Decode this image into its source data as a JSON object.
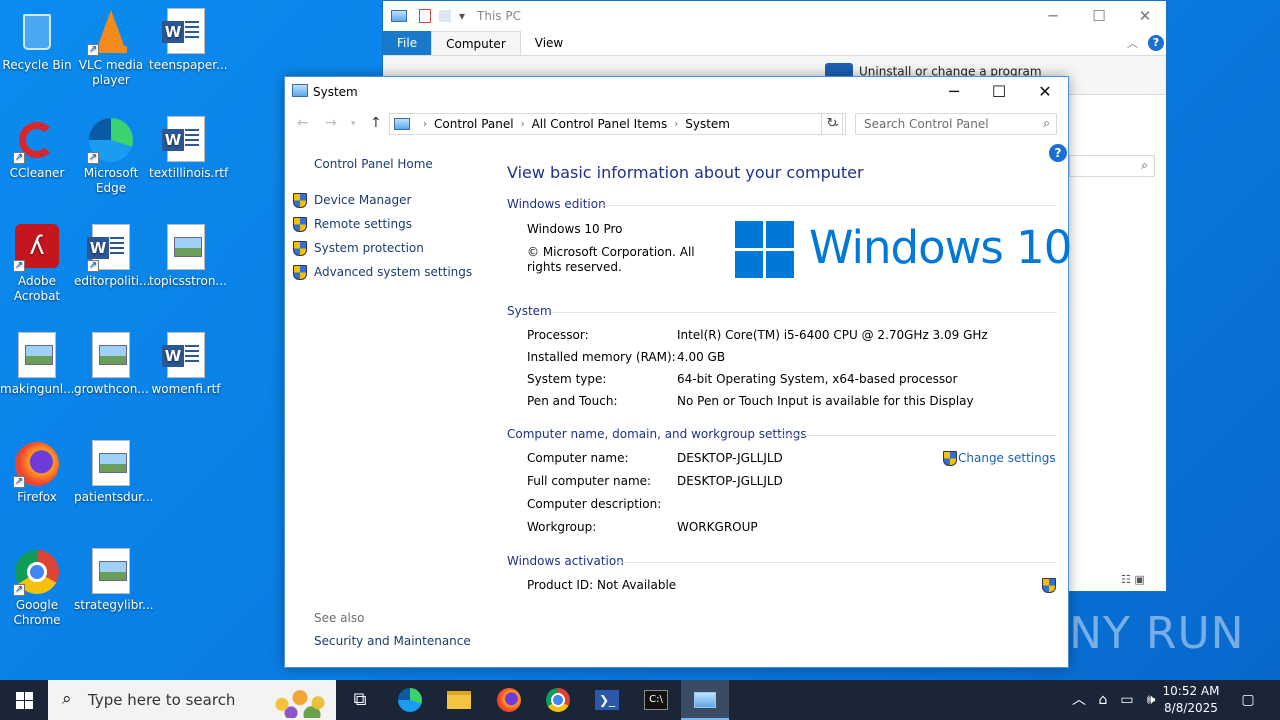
{
  "desktop": {
    "icons": [
      {
        "label": "Recycle Bin",
        "icon": "recycle-bin-icon"
      },
      {
        "label": "VLC media player",
        "icon": "vlc-icon"
      },
      {
        "label": "teenspaper...",
        "icon": "word-doc-icon"
      },
      {
        "label": "CCleaner",
        "icon": "ccleaner-icon"
      },
      {
        "label": "Microsoft Edge",
        "icon": "edge-icon"
      },
      {
        "label": "textillinois.rtf",
        "icon": "word-doc-icon"
      },
      {
        "label": "Adobe Acrobat",
        "icon": "acrobat-icon"
      },
      {
        "label": "editorpoliti...",
        "icon": "word-doc-icon"
      },
      {
        "label": "topicsstron...",
        "icon": "image-file-icon"
      },
      {
        "label": "makingunl...",
        "icon": "image-file-icon"
      },
      {
        "label": "growthcon...",
        "icon": "image-file-icon"
      },
      {
        "label": "womenfi.rtf",
        "icon": "word-doc-icon"
      },
      {
        "label": "Firefox",
        "icon": "firefox-icon"
      },
      {
        "label": "patientsdur...",
        "icon": "image-file-icon"
      },
      {
        "label": "Google Chrome",
        "icon": "chrome-icon"
      },
      {
        "label": "strategylibr...",
        "icon": "image-file-icon"
      }
    ]
  },
  "explorer": {
    "title": "This PC",
    "tabs": {
      "file": "File",
      "computer": "Computer",
      "view": "View"
    },
    "uninstall": "Uninstall or change a program"
  },
  "system_window": {
    "title": "System",
    "breadcrumb": [
      "Control Panel",
      "All Control Panel Items",
      "System"
    ],
    "search_placeholder": "Search Control Panel",
    "left_nav": {
      "home": "Control Panel Home",
      "items": [
        "Device Manager",
        "Remote settings",
        "System protection",
        "Advanced system settings"
      ],
      "see_also": "See also",
      "security": "Security and Maintenance"
    },
    "heading": "View basic information about your computer",
    "edition": {
      "section": "Windows edition",
      "name": "Windows 10 Pro",
      "copyright": "© Microsoft Corporation. All rights reserved.",
      "logo_text": "Windows 10"
    },
    "system": {
      "section": "System",
      "rows": [
        {
          "label": "Processor:",
          "value": "Intel(R) Core(TM) i5-6400 CPU @ 2.70GHz   3.09 GHz"
        },
        {
          "label": "Installed memory (RAM):",
          "value": "4.00 GB"
        },
        {
          "label": "System type:",
          "value": "64-bit Operating System, x64-based processor"
        },
        {
          "label": "Pen and Touch:",
          "value": "No Pen or Touch Input is available for this Display"
        }
      ]
    },
    "computer": {
      "section": "Computer name, domain, and workgroup settings",
      "change": "Change settings",
      "rows": [
        {
          "label": "Computer name:",
          "value": "DESKTOP-JGLLJLD"
        },
        {
          "label": "Full computer name:",
          "value": "DESKTOP-JGLLJLD"
        },
        {
          "label": "Computer description:",
          "value": ""
        },
        {
          "label": "Workgroup:",
          "value": "WORKGROUP"
        }
      ]
    },
    "activation": {
      "section": "Windows activation",
      "product": "Product ID:  Not Available"
    }
  },
  "taskbar": {
    "search_placeholder": "Type here to search",
    "time": "10:52 AM",
    "date": "8/8/2025"
  },
  "watermark": "ANY RUN",
  "colors": {
    "accent": "#0078d7",
    "link": "#1a3d6e",
    "heading": "#1e3287"
  }
}
